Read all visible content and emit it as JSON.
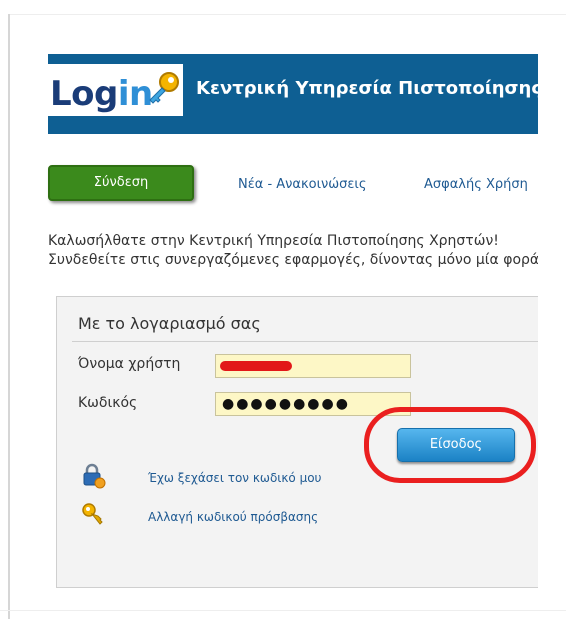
{
  "header": {
    "logo_part1": "Log",
    "logo_part2": "in",
    "title": "Κεντρική Υπηρεσία Πιστοποίησης"
  },
  "nav": {
    "login_button": "Σύνδεση",
    "news": "Νέα - Ανακοινώσεις",
    "safe_use": "Ασφαλής Χρήση"
  },
  "welcome": {
    "line1": "Καλωσήλθατε στην Κεντρική Υπηρεσία Πιστοποίησης Χρηστών!",
    "line2": "Συνδεθείτε στις συνεργαζόμενες εφαρμογές, δίνοντας μόνο μία φορά"
  },
  "login_panel": {
    "title": "Με το λογαριασμό σας",
    "username_label": "Όνομα χρήστη",
    "password_label": "Κωδικός",
    "password_value": "●●●●●●●●●",
    "submit_button": "Είσοδος",
    "forgot_password": "Έχω ξεχάσει τον κωδικό μου",
    "change_password": "Αλλαγή κωδικού πρόσβασης"
  },
  "icons": {
    "logo": "key-icon",
    "forgot": "lock-icon",
    "change": "key-icon"
  },
  "colors": {
    "header_bg": "#0e5f93",
    "login_button": "#3b8a1c",
    "submit_button": "#1b82c5",
    "field_bg": "#fdf7c6",
    "annotation": "#ea1f1f"
  }
}
